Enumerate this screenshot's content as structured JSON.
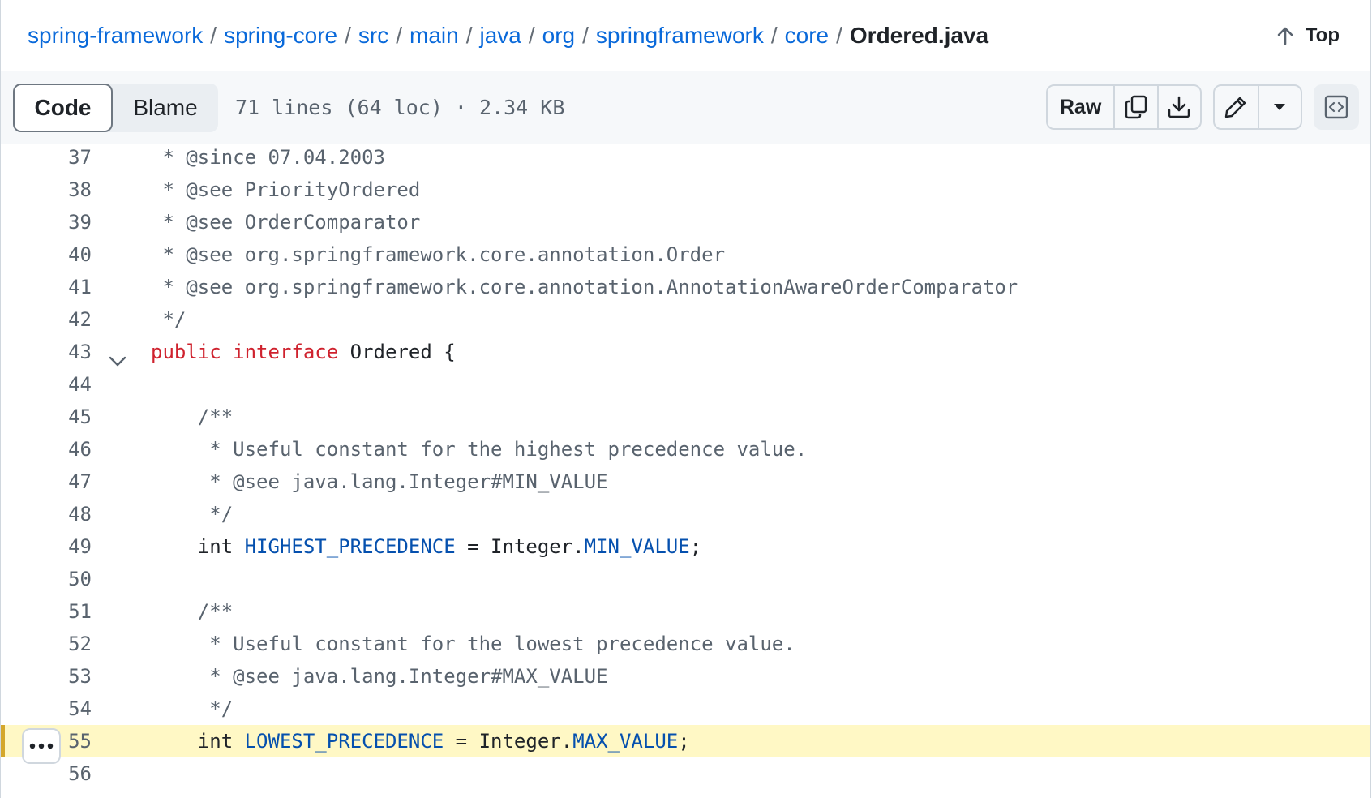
{
  "breadcrumb": {
    "items": [
      "spring-framework",
      "spring-core",
      "src",
      "main",
      "java",
      "org",
      "springframework",
      "core"
    ],
    "separator": "/",
    "current": "Ordered.java"
  },
  "top_link": {
    "label": "Top"
  },
  "toolbar": {
    "tabs": {
      "code": "Code",
      "blame": "Blame"
    },
    "file_meta": "71 lines (64 loc) · 2.34 KB",
    "raw_label": "Raw"
  },
  "code": {
    "lines": [
      {
        "n": "37",
        "segments": [
          {
            "t": " * @since 07.04.2003",
            "c": "cm"
          }
        ]
      },
      {
        "n": "38",
        "segments": [
          {
            "t": " * @see PriorityOrdered",
            "c": "cm"
          }
        ]
      },
      {
        "n": "39",
        "segments": [
          {
            "t": " * @see OrderComparator",
            "c": "cm"
          }
        ]
      },
      {
        "n": "40",
        "segments": [
          {
            "t": " * @see org.springframework.core.annotation.Order",
            "c": "cm"
          }
        ]
      },
      {
        "n": "41",
        "segments": [
          {
            "t": " * @see org.springframework.core.annotation.AnnotationAwareOrderComparator",
            "c": "cm"
          }
        ]
      },
      {
        "n": "42",
        "segments": [
          {
            "t": " */",
            "c": "cm"
          }
        ]
      },
      {
        "n": "43",
        "fold": true,
        "segments": [
          {
            "t": "public",
            "c": "kw"
          },
          {
            "t": " ",
            "c": ""
          },
          {
            "t": "interface",
            "c": "kw"
          },
          {
            "t": " Ordered {",
            "c": ""
          }
        ]
      },
      {
        "n": "44",
        "segments": []
      },
      {
        "n": "45",
        "segments": [
          {
            "t": "    /**",
            "c": "cm"
          }
        ]
      },
      {
        "n": "46",
        "segments": [
          {
            "t": "     * Useful constant for the highest precedence value.",
            "c": "cm"
          }
        ]
      },
      {
        "n": "47",
        "segments": [
          {
            "t": "     * @see java.lang.Integer#MIN_VALUE",
            "c": "cm"
          }
        ]
      },
      {
        "n": "48",
        "segments": [
          {
            "t": "     */",
            "c": "cm"
          }
        ]
      },
      {
        "n": "49",
        "segments": [
          {
            "t": "    int ",
            "c": ""
          },
          {
            "t": "HIGHEST_PRECEDENCE",
            "c": "cn"
          },
          {
            "t": " = Integer.",
            "c": ""
          },
          {
            "t": "MIN_VALUE",
            "c": "cn"
          },
          {
            "t": ";",
            "c": ""
          }
        ]
      },
      {
        "n": "50",
        "segments": []
      },
      {
        "n": "51",
        "segments": [
          {
            "t": "    /**",
            "c": "cm"
          }
        ]
      },
      {
        "n": "52",
        "segments": [
          {
            "t": "     * Useful constant for the lowest precedence value.",
            "c": "cm"
          }
        ]
      },
      {
        "n": "53",
        "segments": [
          {
            "t": "     * @see java.lang.Integer#MAX_VALUE",
            "c": "cm"
          }
        ]
      },
      {
        "n": "54",
        "segments": [
          {
            "t": "     */",
            "c": "cm"
          }
        ]
      },
      {
        "n": "55",
        "highlighted": true,
        "segments": [
          {
            "t": "    int ",
            "c": ""
          },
          {
            "t": "LOWEST_PRECEDENCE",
            "c": "cn"
          },
          {
            "t": " = Integer.",
            "c": ""
          },
          {
            "t": "MAX_VALUE",
            "c": "cn"
          },
          {
            "t": ";",
            "c": ""
          }
        ]
      },
      {
        "n": "56",
        "segments": []
      }
    ]
  },
  "colors": {
    "link": "#0969da",
    "comment": "#59636e",
    "keyword": "#cf222e",
    "constant": "#0550ae",
    "highlight": "#fff8c5"
  },
  "icons": [
    "arrow-up-icon",
    "copy-icon",
    "download-icon",
    "pencil-icon",
    "triangle-down-icon",
    "code-square-icon",
    "kebab-horizontal-icon",
    "chevron-down-icon"
  ]
}
